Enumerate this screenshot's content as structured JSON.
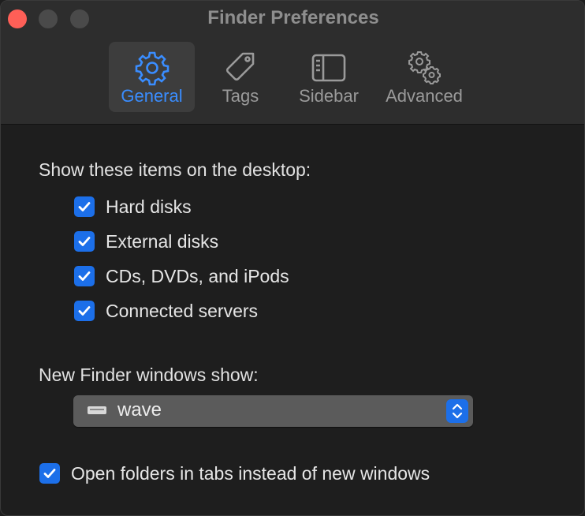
{
  "window": {
    "title": "Finder Preferences"
  },
  "tabs": [
    {
      "label": "General",
      "icon": "gear-icon",
      "selected": true
    },
    {
      "label": "Tags",
      "icon": "tag-icon",
      "selected": false
    },
    {
      "label": "Sidebar",
      "icon": "sidebar-icon",
      "selected": false
    },
    {
      "label": "Advanced",
      "icon": "gears-icon",
      "selected": false
    }
  ],
  "desktop_section": {
    "heading": "Show these items on the desktop:",
    "items": [
      {
        "label": "Hard disks",
        "checked": true
      },
      {
        "label": "External disks",
        "checked": true
      },
      {
        "label": "CDs, DVDs, and iPods",
        "checked": true
      },
      {
        "label": "Connected servers",
        "checked": true
      }
    ]
  },
  "new_window": {
    "label": "New Finder windows show:",
    "value": "wave",
    "icon": "drive-icon"
  },
  "tabs_option": {
    "label": "Open folders in tabs instead of new windows",
    "checked": true
  },
  "colors": {
    "accent": "#1c6fe9",
    "selected_tab_text": "#3a8dff",
    "close_button": "#fe5f57"
  }
}
